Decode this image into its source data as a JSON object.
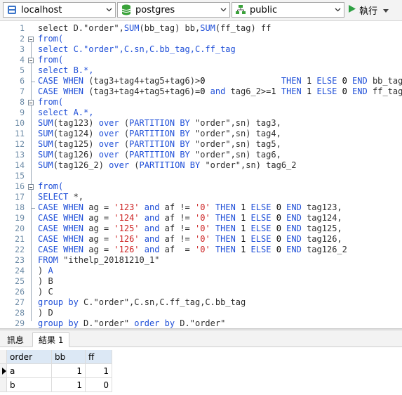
{
  "toolbar": {
    "connection": "localhost",
    "database": "postgres",
    "schema": "public",
    "run_label": "執行"
  },
  "tabs": [
    "訊息",
    "結果 1"
  ],
  "editor": {
    "lines": [
      {
        "n": "1",
        "tokens": [
          [
            "select D.\"order\",",
            ""
          ],
          [
            "SUM",
            "kw"
          ],
          [
            "(bb_tag) bb,",
            ""
          ],
          [
            "SUM",
            "kw"
          ],
          [
            "(ff_tag) ff",
            ""
          ]
        ]
      },
      {
        "n": "2",
        "tokens": [
          [
            "from(",
            "kw"
          ]
        ]
      },
      {
        "n": "3",
        "tokens": [
          [
            "select C.\"order\",C.sn,C.bb_tag,C.ff_tag",
            "kw2"
          ]
        ]
      },
      {
        "n": "4",
        "tokens": [
          [
            "from(",
            "kw"
          ]
        ]
      },
      {
        "n": "5",
        "tokens": [
          [
            "select B.*,",
            "kw2"
          ]
        ]
      },
      {
        "n": "6",
        "tokens": [
          [
            "CASE WHEN",
            "kw"
          ],
          [
            " (tag3+tag4+tag5+tag6)>",
            ""
          ],
          [
            "0",
            "num"
          ],
          [
            "               ",
            ""
          ],
          [
            "THEN",
            "kw"
          ],
          [
            " ",
            ""
          ],
          [
            "1",
            "num"
          ],
          [
            " ",
            ""
          ],
          [
            "ELSE",
            "kw"
          ],
          [
            " ",
            ""
          ],
          [
            "0",
            "num"
          ],
          [
            " ",
            ""
          ],
          [
            "END",
            "kw"
          ],
          [
            " bb_tag,",
            ""
          ]
        ]
      },
      {
        "n": "7",
        "tokens": [
          [
            "CASE WHEN",
            "kw"
          ],
          [
            " (tag3+tag4+tag5+tag6)=",
            ""
          ],
          [
            "0",
            "num"
          ],
          [
            " ",
            ""
          ],
          [
            "and",
            "kw"
          ],
          [
            " tag6_2>=",
            ""
          ],
          [
            "1",
            "num"
          ],
          [
            " ",
            ""
          ],
          [
            "THEN",
            "kw"
          ],
          [
            " ",
            ""
          ],
          [
            "1",
            "num"
          ],
          [
            " ",
            ""
          ],
          [
            "ELSE",
            "kw"
          ],
          [
            " ",
            ""
          ],
          [
            "0",
            "num"
          ],
          [
            " ",
            ""
          ],
          [
            "END",
            "kw"
          ],
          [
            " ff_tag",
            ""
          ]
        ]
      },
      {
        "n": "8",
        "tokens": [
          [
            "from(",
            "kw"
          ]
        ]
      },
      {
        "n": "9",
        "tokens": [
          [
            "select A.*,",
            "kw2"
          ]
        ]
      },
      {
        "n": "10",
        "tokens": [
          [
            "SUM",
            "kw"
          ],
          [
            "(tag123) ",
            ""
          ],
          [
            "over",
            "kw"
          ],
          [
            " (",
            ""
          ],
          [
            "PARTITION BY",
            "kw"
          ],
          [
            " \"order\",sn) tag3,",
            ""
          ]
        ]
      },
      {
        "n": "11",
        "tokens": [
          [
            "SUM",
            "kw"
          ],
          [
            "(tag124) ",
            ""
          ],
          [
            "over",
            "kw"
          ],
          [
            " (",
            ""
          ],
          [
            "PARTITION BY",
            "kw"
          ],
          [
            " \"order\",sn) tag4,",
            ""
          ]
        ]
      },
      {
        "n": "12",
        "tokens": [
          [
            "SUM",
            "kw"
          ],
          [
            "(tag125) ",
            ""
          ],
          [
            "over",
            "kw"
          ],
          [
            " (",
            ""
          ],
          [
            "PARTITION BY",
            "kw"
          ],
          [
            " \"order\",sn) tag5,",
            ""
          ]
        ]
      },
      {
        "n": "13",
        "tokens": [
          [
            "SUM",
            "kw"
          ],
          [
            "(tag126) ",
            ""
          ],
          [
            "over",
            "kw"
          ],
          [
            " (",
            ""
          ],
          [
            "PARTITION BY",
            "kw"
          ],
          [
            " \"order\",sn) tag6,",
            ""
          ]
        ]
      },
      {
        "n": "14",
        "tokens": [
          [
            "SUM",
            "kw"
          ],
          [
            "(tag126_2) ",
            ""
          ],
          [
            "over",
            "kw"
          ],
          [
            " (",
            ""
          ],
          [
            "PARTITION BY",
            "kw"
          ],
          [
            " \"order\",sn) tag6_2",
            ""
          ]
        ]
      },
      {
        "n": "15",
        "tokens": []
      },
      {
        "n": "16",
        "tokens": [
          [
            "from(",
            "kw"
          ]
        ]
      },
      {
        "n": "17",
        "tokens": [
          [
            "SELECT",
            "kw"
          ],
          [
            " *,",
            ""
          ]
        ]
      },
      {
        "n": "18",
        "tokens": [
          [
            "CASE WHEN",
            "kw"
          ],
          [
            " ag = ",
            ""
          ],
          [
            "'123'",
            "str"
          ],
          [
            " ",
            ""
          ],
          [
            "and",
            "kw"
          ],
          [
            " af != ",
            ""
          ],
          [
            "'0'",
            "str"
          ],
          [
            " ",
            ""
          ],
          [
            "THEN",
            "kw"
          ],
          [
            " ",
            ""
          ],
          [
            "1",
            "num"
          ],
          [
            " ",
            ""
          ],
          [
            "ELSE",
            "kw"
          ],
          [
            " ",
            ""
          ],
          [
            "0",
            "num"
          ],
          [
            " ",
            ""
          ],
          [
            "END",
            "kw"
          ],
          [
            " tag123,",
            ""
          ]
        ]
      },
      {
        "n": "19",
        "tokens": [
          [
            "CASE WHEN",
            "kw"
          ],
          [
            " ag = ",
            ""
          ],
          [
            "'124'",
            "str"
          ],
          [
            " ",
            ""
          ],
          [
            "and",
            "kw"
          ],
          [
            " af != ",
            ""
          ],
          [
            "'0'",
            "str"
          ],
          [
            " ",
            ""
          ],
          [
            "THEN",
            "kw"
          ],
          [
            " ",
            ""
          ],
          [
            "1",
            "num"
          ],
          [
            " ",
            ""
          ],
          [
            "ELSE",
            "kw"
          ],
          [
            " ",
            ""
          ],
          [
            "0",
            "num"
          ],
          [
            " ",
            ""
          ],
          [
            "END",
            "kw"
          ],
          [
            " tag124,",
            ""
          ]
        ]
      },
      {
        "n": "20",
        "tokens": [
          [
            "CASE WHEN",
            "kw"
          ],
          [
            " ag = ",
            ""
          ],
          [
            "'125'",
            "str"
          ],
          [
            " ",
            ""
          ],
          [
            "and",
            "kw"
          ],
          [
            " af != ",
            ""
          ],
          [
            "'0'",
            "str"
          ],
          [
            " ",
            ""
          ],
          [
            "THEN",
            "kw"
          ],
          [
            " ",
            ""
          ],
          [
            "1",
            "num"
          ],
          [
            " ",
            ""
          ],
          [
            "ELSE",
            "kw"
          ],
          [
            " ",
            ""
          ],
          [
            "0",
            "num"
          ],
          [
            " ",
            ""
          ],
          [
            "END",
            "kw"
          ],
          [
            " tag125,",
            ""
          ]
        ]
      },
      {
        "n": "21",
        "tokens": [
          [
            "CASE WHEN",
            "kw"
          ],
          [
            " ag = ",
            ""
          ],
          [
            "'126'",
            "str"
          ],
          [
            " ",
            ""
          ],
          [
            "and",
            "kw"
          ],
          [
            " af != ",
            ""
          ],
          [
            "'0'",
            "str"
          ],
          [
            " ",
            ""
          ],
          [
            "THEN",
            "kw"
          ],
          [
            " ",
            ""
          ],
          [
            "1",
            "num"
          ],
          [
            " ",
            ""
          ],
          [
            "ELSE",
            "kw"
          ],
          [
            " ",
            ""
          ],
          [
            "0",
            "num"
          ],
          [
            " ",
            ""
          ],
          [
            "END",
            "kw"
          ],
          [
            " tag126,",
            ""
          ]
        ]
      },
      {
        "n": "22",
        "tokens": [
          [
            "CASE WHEN",
            "kw"
          ],
          [
            " ag = ",
            ""
          ],
          [
            "'126'",
            "str"
          ],
          [
            " ",
            ""
          ],
          [
            "and",
            "kw"
          ],
          [
            " af  = ",
            ""
          ],
          [
            "'0'",
            "str"
          ],
          [
            " ",
            ""
          ],
          [
            "THEN",
            "kw"
          ],
          [
            " ",
            ""
          ],
          [
            "1",
            "num"
          ],
          [
            " ",
            ""
          ],
          [
            "ELSE",
            "kw"
          ],
          [
            " ",
            ""
          ],
          [
            "0",
            "num"
          ],
          [
            " ",
            ""
          ],
          [
            "END",
            "kw"
          ],
          [
            " tag126_2",
            ""
          ]
        ]
      },
      {
        "n": "23",
        "tokens": [
          [
            "FROM",
            "kw"
          ],
          [
            " \"ithelp_20181210_1\"",
            ""
          ]
        ]
      },
      {
        "n": "24",
        "tokens": [
          [
            ") ",
            ""
          ],
          [
            "A",
            "kw"
          ]
        ]
      },
      {
        "n": "25",
        "tokens": [
          [
            ") B",
            ""
          ]
        ]
      },
      {
        "n": "26",
        "tokens": [
          [
            ") C",
            ""
          ]
        ]
      },
      {
        "n": "27",
        "tokens": [
          [
            "group by",
            "kw"
          ],
          [
            " C.\"order\",C.sn,C.ff_tag,C.bb_tag",
            ""
          ]
        ]
      },
      {
        "n": "28",
        "tokens": [
          [
            ") D",
            ""
          ]
        ]
      },
      {
        "n": "29",
        "tokens": [
          [
            "group by",
            "kw"
          ],
          [
            " D.\"order\" ",
            ""
          ],
          [
            "order by",
            "kw"
          ],
          [
            " D.\"order\"",
            ""
          ]
        ]
      }
    ]
  },
  "result": {
    "columns": [
      "order",
      "bb",
      "ff"
    ],
    "rows": [
      [
        "a",
        "1",
        "1"
      ],
      [
        "b",
        "1",
        "0"
      ]
    ]
  }
}
